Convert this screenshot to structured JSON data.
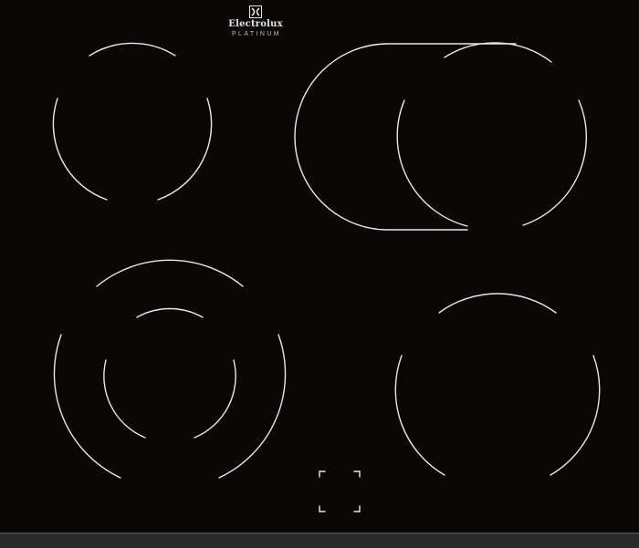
{
  "brand": {
    "logo_icon": "electrolux-logo-icon",
    "name": "Electrolux",
    "line": "PLATINUM",
    "text_color": "#e6e6e6"
  },
  "colors": {
    "glass": "#0a0707",
    "edge": "#2a2a2a",
    "marking": "#e8e8e8"
  },
  "zones": [
    {
      "name": "zone-rear-left",
      "type": "single"
    },
    {
      "name": "zone-rear-right",
      "type": "oval-extendable"
    },
    {
      "name": "zone-front-left",
      "type": "dual-circuit"
    },
    {
      "name": "zone-front-right",
      "type": "single"
    }
  ],
  "controls": {
    "bridge_marker_icon": "control-bracket-icon"
  }
}
